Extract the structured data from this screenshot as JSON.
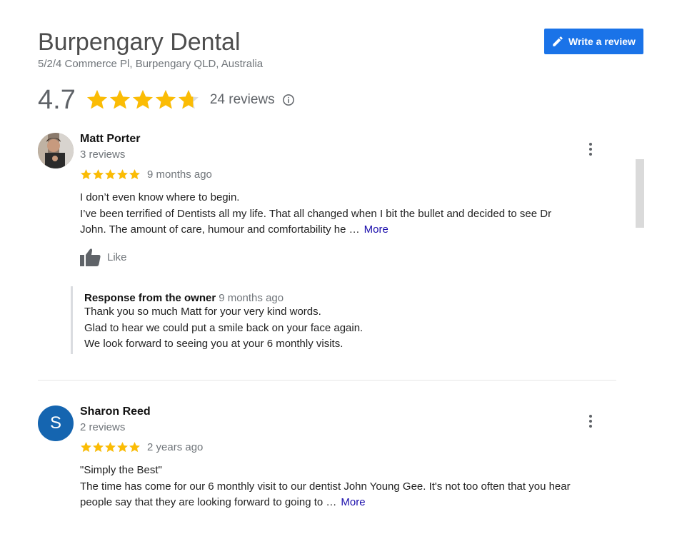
{
  "business": {
    "name": "Burpengary Dental",
    "address": "5/2/4 Commerce Pl, Burpengary QLD, Australia",
    "rating": "4.7",
    "rating_value": 4.7,
    "review_count": "24 reviews"
  },
  "write_review": {
    "label": "Write a review",
    "icon": "pencil-icon"
  },
  "colors": {
    "star": "#fbbc04",
    "star_empty": "#dadce0",
    "accent": "#1a73e8",
    "link": "#1a0dab",
    "avatar_bg": "#1565b0"
  },
  "reviews": [
    {
      "name": "Matt Porter",
      "count": "3 reviews",
      "stars": 5,
      "date": "9 months ago",
      "lines": [
        "I don’t even know where to begin.",
        "I’ve been terrified of Dentists all my life. That all changed when I bit the bullet and decided to see Dr",
        "John. The amount of care, humour and comfortability he …"
      ],
      "more": "More",
      "like": "Like",
      "owner_response": {
        "title": "Response from the owner",
        "date": "9 months ago",
        "lines": [
          "Thank you so much Matt for your very kind words.",
          "Glad to hear we could put a smile back on your face again.",
          "We look forward to seeing you at your 6 monthly visits."
        ]
      }
    },
    {
      "name": "Sharon Reed",
      "initial": "S",
      "count": "2 reviews",
      "stars": 5,
      "date": "2 years ago",
      "lines": [
        "\"Simply the Best\"",
        "The time has come for our 6 monthly visit to our dentist John Young Gee. It's not too often that you hear",
        "people say that they are looking forward to going to …"
      ],
      "more": "More"
    }
  ]
}
